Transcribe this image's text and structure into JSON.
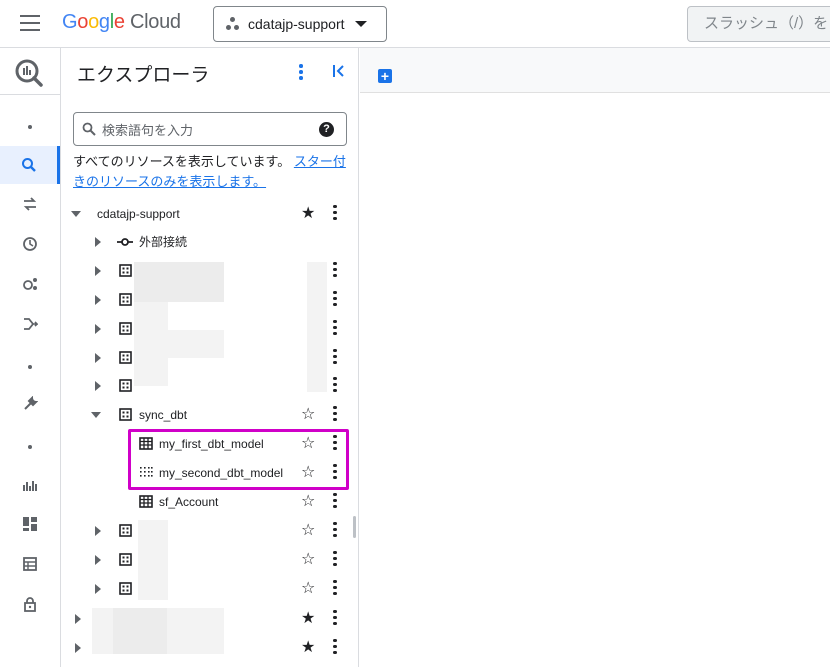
{
  "header": {
    "logo_google": [
      "G",
      "o",
      "o",
      "g",
      "l",
      "e"
    ],
    "logo_cloud": "Cloud",
    "project_name": "cdatajp-support",
    "search_placeholder": "スラッシュ（/）を"
  },
  "explorer": {
    "title": "エクスプローラ",
    "search_placeholder": "検索語句を入力",
    "info_text": "すべてのリソースを表示しています。",
    "info_link": "スター付きのリソースのみを表示します。",
    "tree": {
      "project": "cdatajp-support",
      "external": "外部接続",
      "dataset_open": "sync_dbt",
      "tables": [
        "my_first_dbt_model",
        "my_second_dbt_model",
        "sf_Account"
      ]
    }
  },
  "colors": {
    "accent": "#1a73e8",
    "highlight": "#d000c8"
  }
}
